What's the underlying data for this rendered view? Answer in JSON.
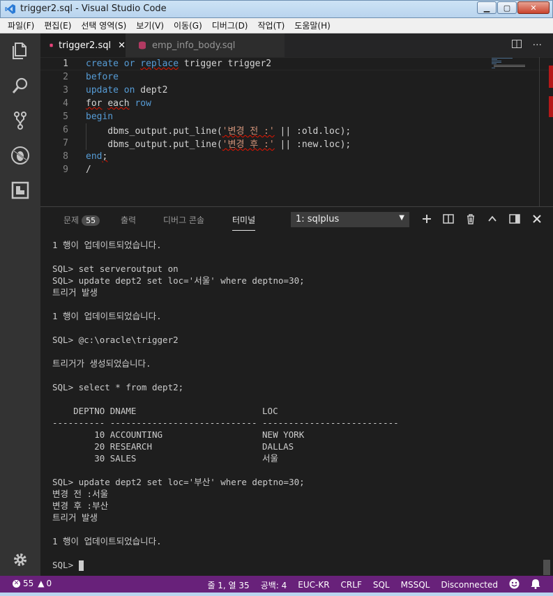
{
  "window": {
    "title": "trigger2.sql - Visual Studio Code",
    "minimize": "▁",
    "maximize": "▢",
    "close": "✕"
  },
  "menu": [
    "파일(F)",
    "편집(E)",
    "선택 영역(S)",
    "보기(V)",
    "이동(G)",
    "디버그(D)",
    "작업(T)",
    "도움말(H)"
  ],
  "tabs": [
    {
      "label": "trigger2.sql",
      "active": true,
      "close": "✕"
    },
    {
      "label": "emp_info_body.sql",
      "active": false
    }
  ],
  "editor": {
    "line_numbers": [
      "1",
      "2",
      "3",
      "4",
      "5",
      "6",
      "7",
      "8",
      "9"
    ],
    "current_line": 1
  },
  "panel": {
    "tabs": {
      "problems": "문제",
      "problems_count": "55",
      "output": "출력",
      "debug_console": "디버그 콘솔",
      "terminal": "터미널"
    },
    "terminal_select": "1: sqlplus",
    "terminal_lines": [
      "1 행이 업데이트되었습니다.",
      "",
      "SQL> set serveroutput on",
      "SQL> update dept2 set loc='서울' where deptno=30;",
      "트리거 발생",
      "",
      "1 행이 업데이트되었습니다.",
      "",
      "SQL> @c:\\oracle\\trigger2",
      "",
      "트리거가 생성되었습니다.",
      "",
      "SQL> select * from dept2;",
      "",
      "    DEPTNO DNAME                        LOC",
      "---------- ---------------------------- --------------------------",
      "        10 ACCOUNTING                   NEW YORK",
      "        20 RESEARCH                     DALLAS",
      "        30 SALES                        서울",
      "",
      "SQL> update dept2 set loc='부산' where deptno=30;",
      "변경 전 :서울",
      "변경 후 :부산",
      "트리거 발생",
      "",
      "1 행이 업데이트되었습니다.",
      "",
      "SQL> "
    ]
  },
  "status": {
    "errors": "55",
    "warnings": "0",
    "position": "줄 1, 열 35",
    "spaces": "공백: 4",
    "encoding": "EUC-KR",
    "eol": "CRLF",
    "language": "SQL",
    "provider": "MSSQL",
    "connection": "Disconnected"
  },
  "colors": {
    "statusbar": "#68217a",
    "keyword": "#569cd6",
    "string": "#ce9178",
    "error_squiggle": "#e51400"
  }
}
